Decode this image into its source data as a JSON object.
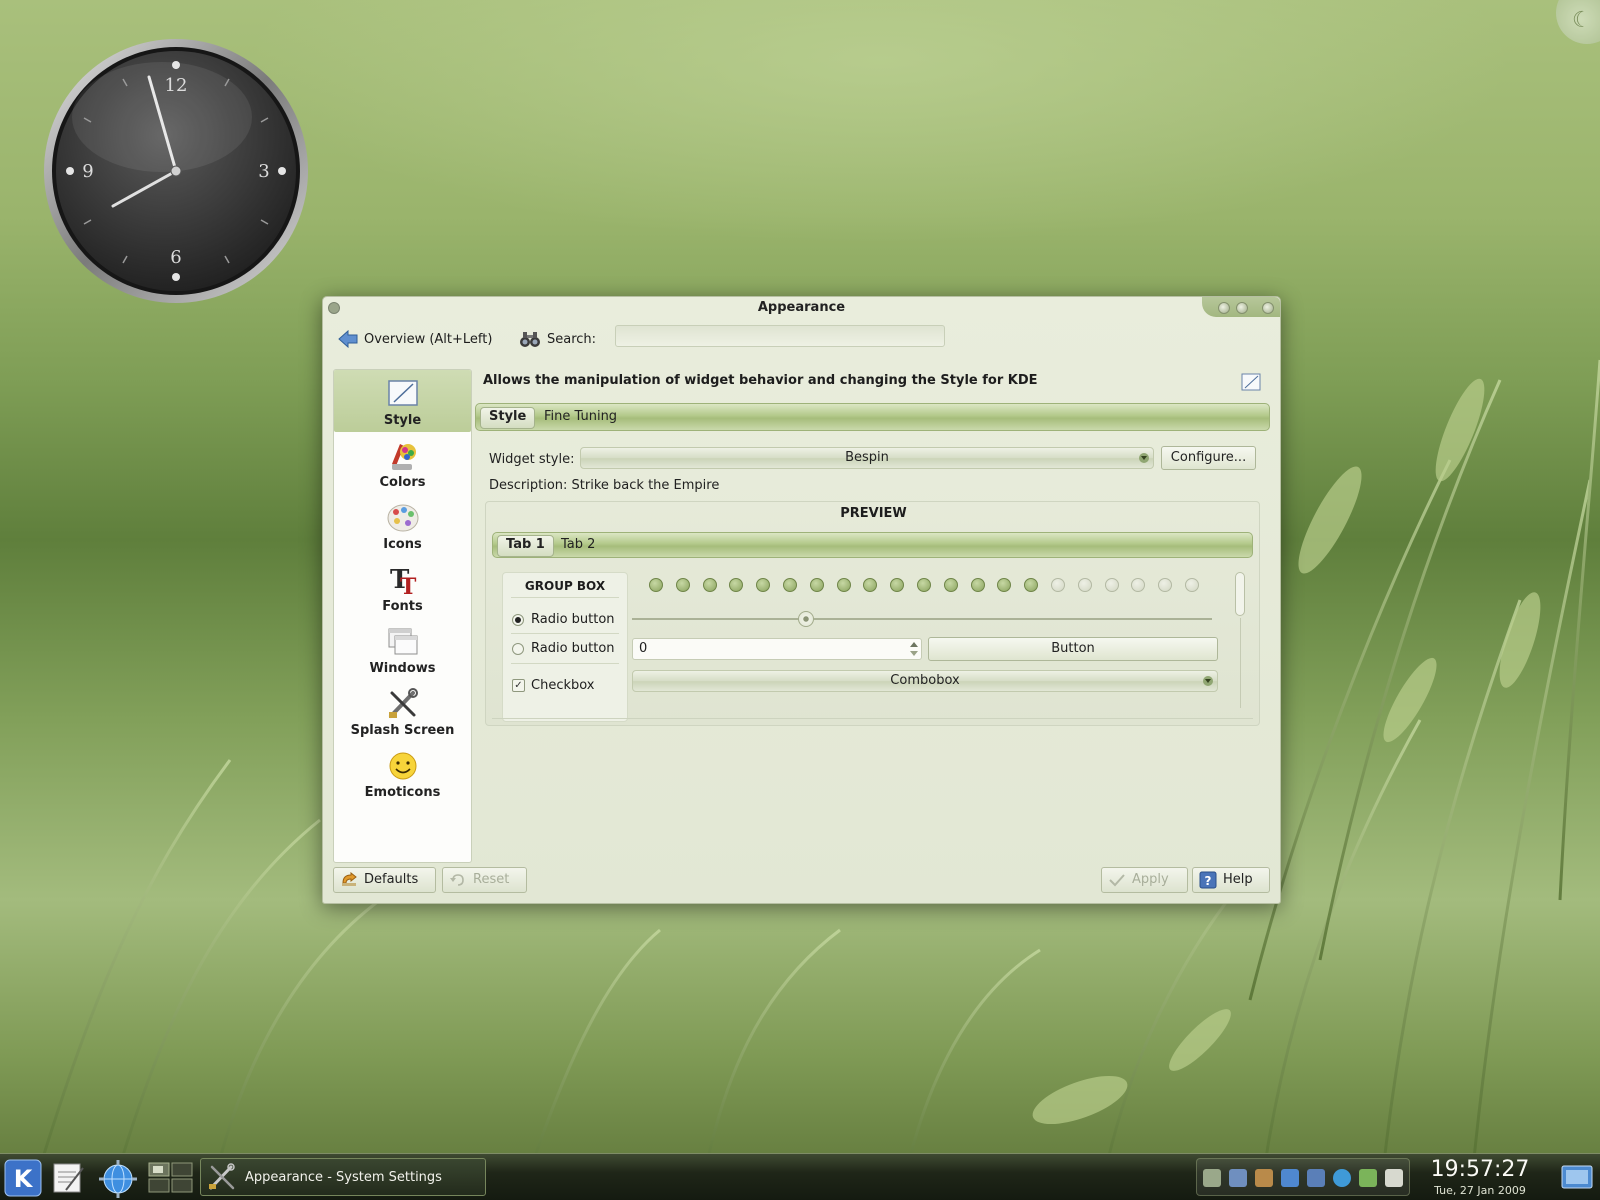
{
  "window": {
    "title": "Appearance"
  },
  "toolbar": {
    "overview_label": "Overview (Alt+Left)",
    "search_label": "Search:",
    "search_value": "",
    "search_placeholder": ""
  },
  "sidebar": {
    "items": [
      {
        "label": "Style",
        "icon": "style-icon"
      },
      {
        "label": "Colors",
        "icon": "colors-icon"
      },
      {
        "label": "Icons",
        "icon": "icons-icon"
      },
      {
        "label": "Fonts",
        "icon": "fonts-icon"
      },
      {
        "label": "Windows",
        "icon": "windows-icon"
      },
      {
        "label": "Splash Screen",
        "icon": "splash-screen-icon"
      },
      {
        "label": "Emoticons",
        "icon": "emoticons-icon"
      }
    ],
    "selected": "Style"
  },
  "panel": {
    "description": "Allows the manipulation of widget behavior and changing the Style for KDE",
    "tabs": [
      {
        "label": "Style"
      },
      {
        "label": "Fine Tuning"
      }
    ],
    "active_tab": "Style",
    "widget_style_label": "Widget style:",
    "widget_style_value": "Bespin",
    "configure_label": "Configure...",
    "description_line": "Description: Strike back the Empire"
  },
  "preview": {
    "title": "PREVIEW",
    "tabs": [
      {
        "label": "Tab 1"
      },
      {
        "label": "Tab 2"
      }
    ],
    "active_tab": "Tab 1",
    "group_box_title": "GROUP BOX",
    "radio1_label": "Radio button",
    "radio2_label": "Radio button",
    "radio1_checked": true,
    "radio2_checked": false,
    "checkbox_label": "Checkbox",
    "checkbox_checked": true,
    "progress_total_leds": 21,
    "progress_lit_leds": 15,
    "slider_value": 0.3,
    "spinbox_value": "0",
    "button_label": "Button",
    "combobox_label": "Combobox"
  },
  "buttons": {
    "defaults": "Defaults",
    "reset": "Reset",
    "apply": "Apply",
    "help": "Help"
  },
  "taskbar": {
    "task_label": "Appearance - System Settings",
    "time": "19:57:27",
    "date": "Tue, 27 Jan 2009"
  },
  "colors": {
    "accent": "#a6bd7b",
    "led_on": "#8aa35e",
    "led_off": "#d2d7c3"
  },
  "clock_widget": {
    "numerals": [
      "12",
      "3",
      "6",
      "9"
    ],
    "hour": 7,
    "minute": 57
  }
}
